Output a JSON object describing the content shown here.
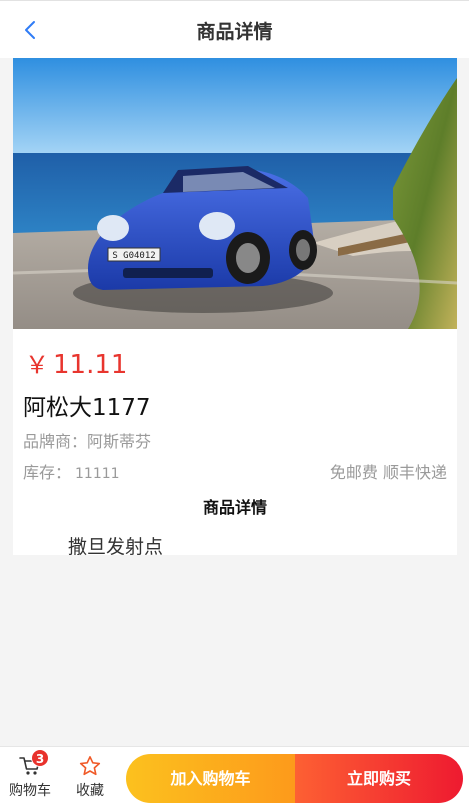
{
  "header": {
    "title": "商品详情",
    "back_icon": "chevron-left-icon",
    "back_color": "#2f7cf6"
  },
  "product": {
    "image_subject": "blue convertible sports car",
    "plate_text": "S G04012",
    "currency": "￥",
    "price": "11.11",
    "name": "阿松大1177",
    "brand_label": "品牌商：",
    "brand": "阿斯蒂芬",
    "stock_label": "库存：",
    "stock": "11111",
    "shipping": "免邮费 顺丰快递",
    "price_color": "#e8352e"
  },
  "details": {
    "heading": "商品详情",
    "body": "撒旦发射点"
  },
  "bottom_bar": {
    "cart": {
      "label": "购物车",
      "badge": "3",
      "icon": "cart-icon"
    },
    "favorite": {
      "label": "收藏",
      "icon": "star-icon",
      "icon_color": "#f05a28"
    },
    "add_to_cart_label": "加入购物车",
    "buy_now_label": "立即购买"
  }
}
